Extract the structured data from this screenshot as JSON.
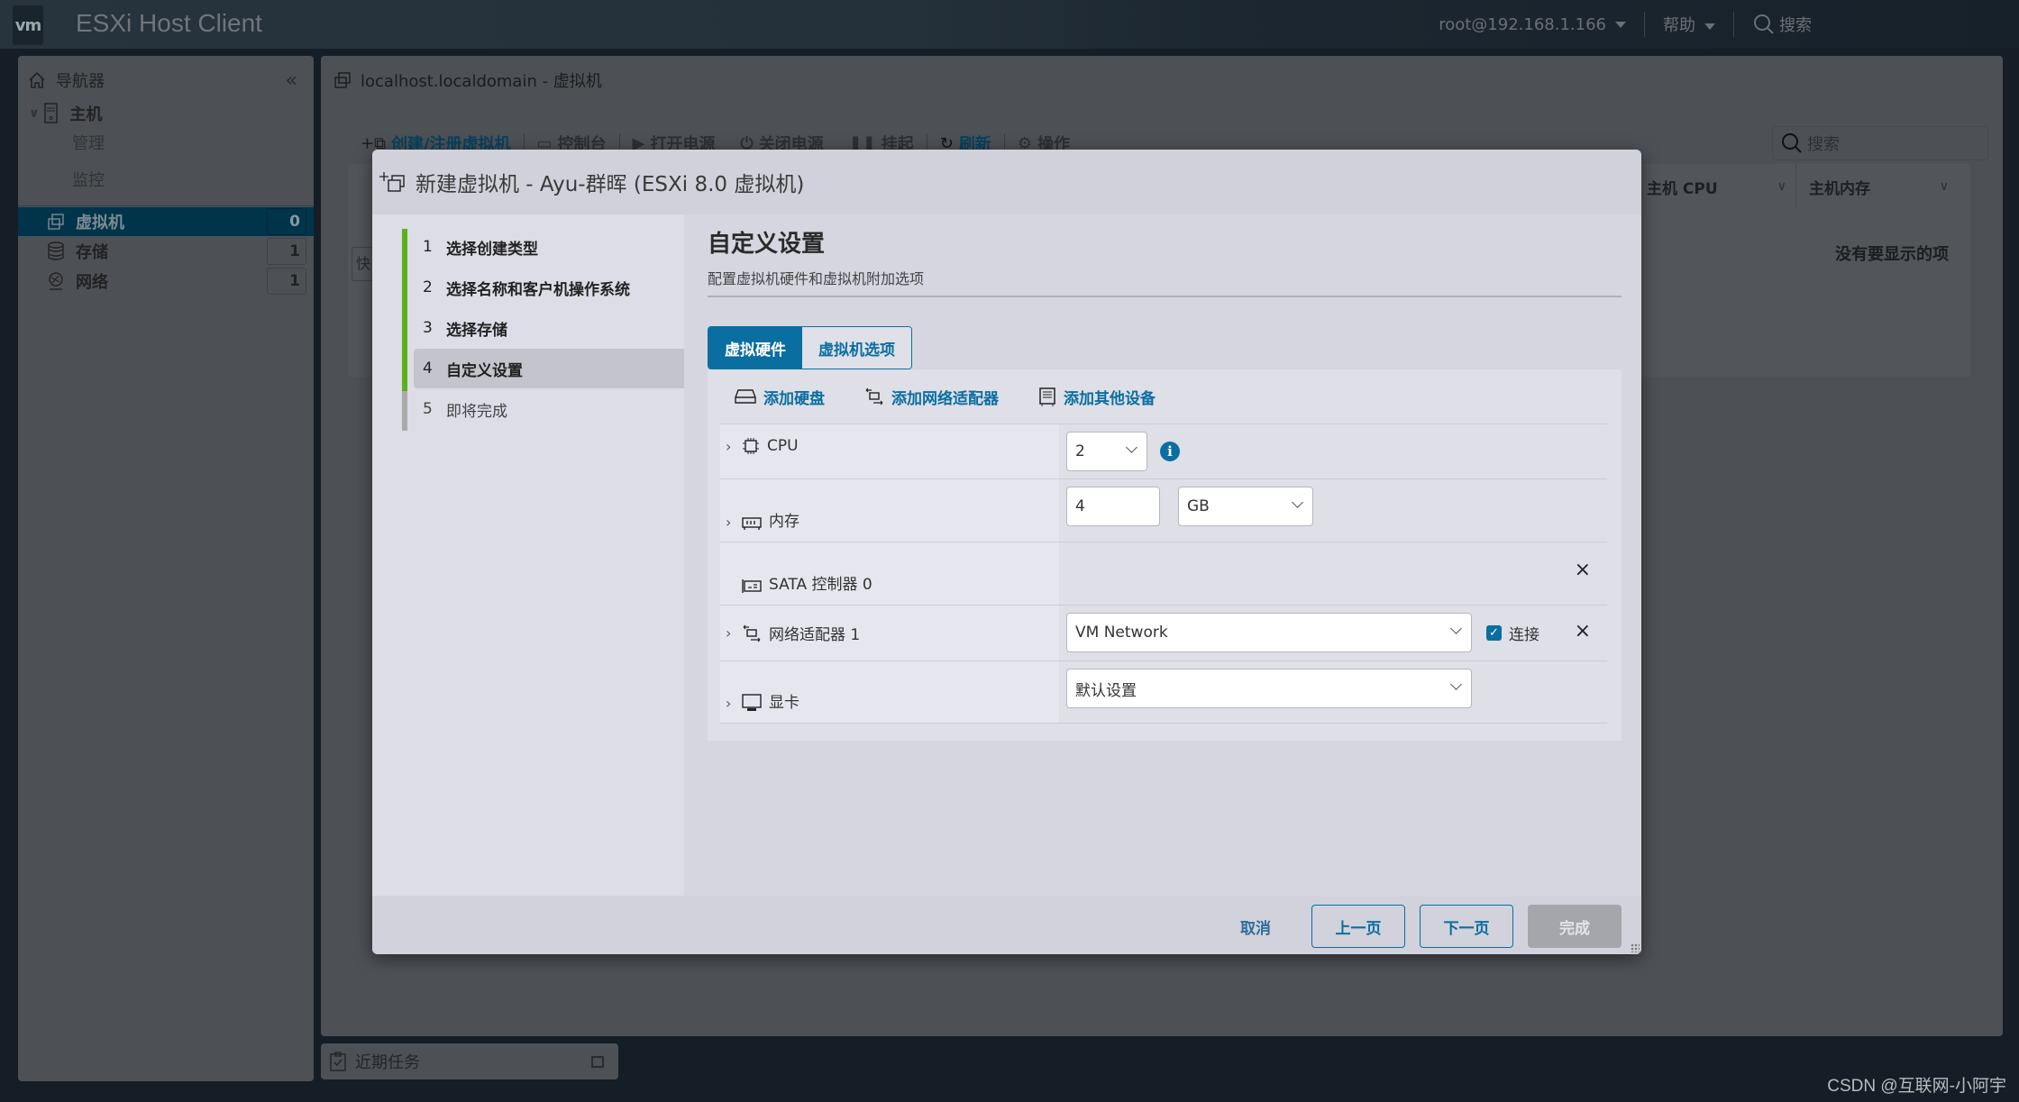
{
  "app": {
    "logo": "vm",
    "title": "ESXi Host Client",
    "user": "root@192.168.1.166",
    "help": "帮助",
    "search": "搜索"
  },
  "navigator": {
    "title": "导航器",
    "host": {
      "label": "主机",
      "children": [
        "管理",
        "监控"
      ]
    },
    "items": [
      {
        "label": "虚拟机",
        "count": "0",
        "selected": true
      },
      {
        "label": "存储",
        "count": "1"
      },
      {
        "label": "网络",
        "count": "1"
      }
    ]
  },
  "main": {
    "title": "localhost.localdomain - 虚拟机",
    "toolbar": [
      {
        "label": "创建/注册虚拟机",
        "icon": "create-vm-icon",
        "active": true
      },
      {
        "label": "控制台",
        "icon": "console-icon"
      },
      {
        "label": "打开电源",
        "icon": "play-icon"
      },
      {
        "label": "关闭电源",
        "icon": "power-icon"
      },
      {
        "label": "挂起",
        "icon": "pause-icon"
      },
      {
        "label": "刷新",
        "icon": "refresh-icon",
        "active": true
      },
      {
        "label": "操作",
        "icon": "gear-icon"
      }
    ],
    "search_placeholder": "搜索",
    "columns": [
      "主机 CPU",
      "主机内存"
    ],
    "empty_text": "没有要显示的项",
    "filter_stub": "快"
  },
  "recent_tasks": {
    "label": "近期任务"
  },
  "watermark": "CSDN @互联网-小阿宇",
  "dialog": {
    "title": "新建虚拟机 - Ayu-群晖 (ESXi 8.0 虚拟机)",
    "steps": [
      {
        "num": "1",
        "label": "选择创建类型",
        "state": "done"
      },
      {
        "num": "2",
        "label": "选择名称和客户机操作系统",
        "state": "done"
      },
      {
        "num": "3",
        "label": "选择存储",
        "state": "done"
      },
      {
        "num": "4",
        "label": "自定义设置",
        "state": "current"
      },
      {
        "num": "5",
        "label": "即将完成",
        "state": "future"
      }
    ],
    "content": {
      "title": "自定义设置",
      "subtitle": "配置虚拟机硬件和虚拟机附加选项",
      "tabs": [
        {
          "label": "虚拟硬件",
          "active": true
        },
        {
          "label": "虚拟机选项",
          "active": false
        }
      ],
      "add_actions": [
        "添加硬盘",
        "添加网络适配器",
        "添加其他设备"
      ],
      "hardware": {
        "cpu": {
          "label": "CPU",
          "value": "2"
        },
        "memory": {
          "label": "内存",
          "value": "4",
          "unit": "GB"
        },
        "sata": {
          "label": "SATA 控制器 0"
        },
        "network": {
          "label": "网络适配器 1",
          "value": "VM Network",
          "connect_label": "连接",
          "connected": true
        },
        "video": {
          "label": "显卡",
          "value": "默认设置"
        }
      }
    },
    "footer": {
      "cancel": "取消",
      "back": "上一页",
      "next": "下一页",
      "finish": "完成"
    }
  },
  "colors": {
    "accent": "#0b6ea0",
    "step_done": "#5cb11a",
    "selected_nav": "#00344b"
  }
}
